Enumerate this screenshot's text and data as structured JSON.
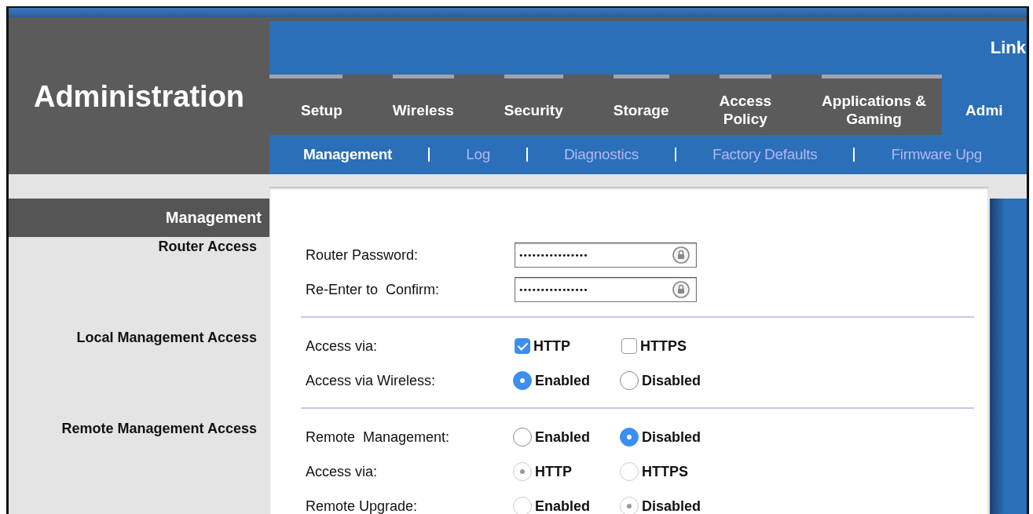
{
  "header": {
    "title": "Administration",
    "brand": "Link"
  },
  "tabs": [
    {
      "label": "Setup",
      "selected": false
    },
    {
      "label": "Wireless",
      "selected": false
    },
    {
      "label": "Security",
      "selected": false
    },
    {
      "label": "Storage",
      "selected": false
    },
    {
      "label": "Access\nPolicy",
      "selected": false
    },
    {
      "label": "Applications &\nGaming",
      "selected": false
    },
    {
      "label": "Admi",
      "selected": true
    }
  ],
  "subtabs": [
    {
      "label": "Management",
      "selected": true
    },
    {
      "label": "Log",
      "selected": false
    },
    {
      "label": "Diagnostics",
      "selected": false
    },
    {
      "label": "Factory Defaults",
      "selected": false
    },
    {
      "label": "Firmware Upg",
      "selected": false
    }
  ],
  "sidebar": {
    "title": "Management"
  },
  "sections": [
    {
      "heading": "Router Access",
      "rows": [
        {
          "kind": "password",
          "label": "Router Password:",
          "value": "••••••••••••••••"
        },
        {
          "kind": "password",
          "label": "Re-Enter to  Confirm:",
          "value": "••••••••••••••••"
        }
      ]
    },
    {
      "heading": "Local Management Access",
      "rows": [
        {
          "kind": "checkbox",
          "label": "Access via:",
          "options": [
            {
              "label": "HTTP",
              "checked": true
            },
            {
              "label": "HTTPS",
              "checked": false
            }
          ]
        },
        {
          "kind": "radio",
          "label": "Access via Wireless:",
          "options": [
            {
              "label": "Enabled",
              "selected": true,
              "disabled": false
            },
            {
              "label": "Disabled",
              "selected": false,
              "disabled": false
            }
          ]
        }
      ]
    },
    {
      "heading": "Remote Management Access",
      "rows": [
        {
          "kind": "radio",
          "label": "Remote  Management:",
          "options": [
            {
              "label": "Enabled",
              "selected": false,
              "disabled": false
            },
            {
              "label": "Disabled",
              "selected": true,
              "disabled": false
            }
          ]
        },
        {
          "kind": "radio",
          "label": "Access via:",
          "options": [
            {
              "label": "HTTP",
              "selected": true,
              "disabled": true
            },
            {
              "label": "HTTPS",
              "selected": false,
              "disabled": true
            }
          ]
        },
        {
          "kind": "radio",
          "label": "Remote Upgrade:",
          "options": [
            {
              "label": "Enabled",
              "selected": false,
              "disabled": true
            },
            {
              "label": "Disabled",
              "selected": true,
              "disabled": true
            }
          ]
        }
      ]
    }
  ]
}
